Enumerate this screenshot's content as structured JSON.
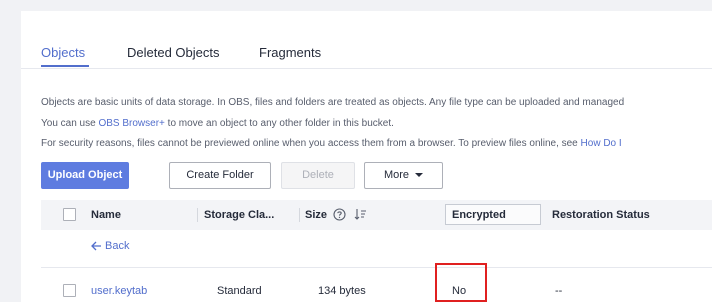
{
  "tabs": [
    {
      "label": "Objects",
      "active": true
    },
    {
      "label": "Deleted Objects",
      "active": false
    },
    {
      "label": "Fragments",
      "active": false
    }
  ],
  "description": {
    "line1": "Objects are basic units of data storage. In OBS, files and folders are treated as objects. Any file type can be uploaded and managed",
    "line2_prefix": "You can use ",
    "line2_link": "OBS Browser+",
    "line2_suffix": " to move an object to any other folder in this bucket.",
    "line3_prefix": "For security reasons, files cannot be previewed online when you access them from a browser. To preview files online, see ",
    "line3_link": "How Do I"
  },
  "toolbar": {
    "upload_label": "Upload Object",
    "create_folder_label": "Create Folder",
    "delete_label": "Delete",
    "more_label": "More"
  },
  "table": {
    "headers": {
      "name": "Name",
      "storage_class": "Storage Cla...",
      "size": "Size",
      "encrypted": "Encrypted",
      "restoration_status": "Restoration Status"
    },
    "back_label": "Back",
    "rows": [
      {
        "name": "user.keytab",
        "storage_class": "Standard",
        "size": "134 bytes",
        "encrypted": "No",
        "restoration_status": "--"
      }
    ]
  },
  "colors": {
    "accent": "#526ecc",
    "primary_button": "#5e7ce0",
    "highlight_box": "#e02020"
  },
  "icons": [
    "help-circle-icon",
    "sort-icon",
    "chevron-down-icon",
    "back-arrow-icon"
  ]
}
